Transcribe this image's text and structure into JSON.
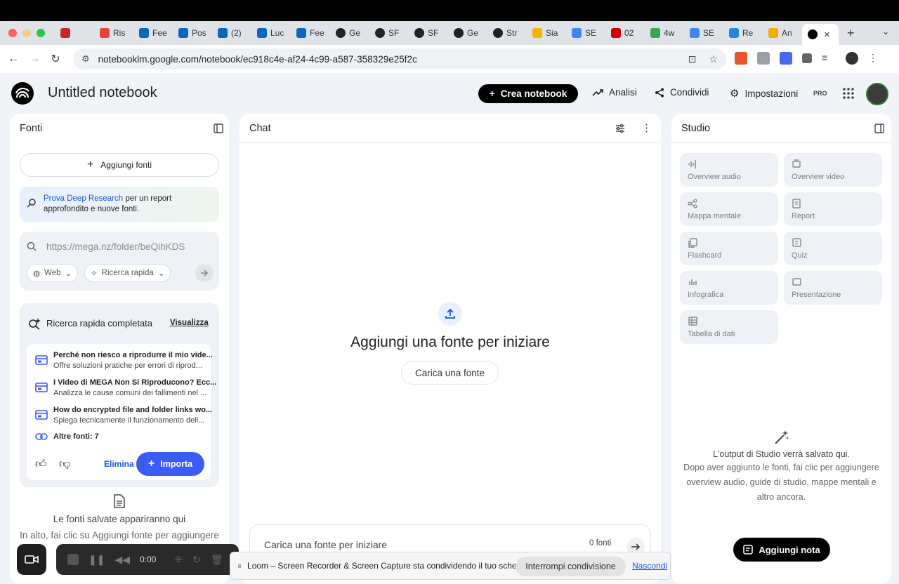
{
  "browser": {
    "tabs": [
      {
        "label": "",
        "color": "#c62828"
      },
      {
        "label": "Ris",
        "color": "#ea4335"
      },
      {
        "label": "Fee",
        "color": "#0a66c2"
      },
      {
        "label": "Pos",
        "color": "#0a66c2"
      },
      {
        "label": "(2)",
        "color": "#0a66c2"
      },
      {
        "label": "Luc",
        "color": "#0a66c2"
      },
      {
        "label": "Fee",
        "color": "#0a66c2"
      },
      {
        "label": "Ge",
        "color": "#222222"
      },
      {
        "label": "SF",
        "color": "#222222"
      },
      {
        "label": "SF",
        "color": "#222222"
      },
      {
        "label": "Ge",
        "color": "#222222"
      },
      {
        "label": "Str",
        "color": "#222222"
      },
      {
        "label": "Sia",
        "color": "#f4b400"
      },
      {
        "label": "SE",
        "color": "#4285f4"
      },
      {
        "label": "02",
        "color": "#d50000"
      },
      {
        "label": "4w",
        "color": "#34a853"
      },
      {
        "label": "SE",
        "color": "#4285f4"
      },
      {
        "label": "Re",
        "color": "#1e88e5"
      },
      {
        "label": "An",
        "color": "#f9ab00"
      }
    ],
    "url": "notebooklm.google.com/notebook/ec918c4e-af24-4c99-a587-358329e25f2c"
  },
  "header": {
    "title": "Untitled notebook",
    "create_label": "Crea notebook",
    "analytics_label": "Analisi",
    "share_label": "Condividi",
    "settings_label": "Impostazioni",
    "pro_label": "PRO"
  },
  "sources": {
    "title": "Fonti",
    "add_label": "Aggiungi fonti",
    "deep_link": "Prova Deep Research",
    "deep_text_1": " per un report",
    "deep_text_2": "approfondito e nuove fonti.",
    "search_placeholder": "https://mega.nz/folder/beQihKDS",
    "chip_web": "Web",
    "chip_quick": "Ricerca rapida",
    "quick": {
      "title": "Ricerca rapida completata",
      "view_label": "Visualizza",
      "items": [
        {
          "title": "Perché non riesco a riprodurre il mio vide...",
          "desc": "Offre soluzioni pratiche per errori di riprod..."
        },
        {
          "title": "I Video di MEGA Non Si Riproducono? Ecc...",
          "desc": "Analizza le cause comuni dei fallimenti nel ..."
        },
        {
          "title": "How do encrypted file and folder links wo...",
          "desc": "Spiega tecnicamente il funzionamento dell..."
        }
      ],
      "more_label": "Altre fonti: 7",
      "delete_label": "Elimina",
      "import_label": "Importa"
    },
    "empty_title": "Le fonti salvate appariranno qui",
    "empty_text": "In alto, fai clic su Aggiungi fonte per aggiungere"
  },
  "chat": {
    "title": "Chat",
    "prompt_title": "Aggiungi una fonte per iniziare",
    "upload_label": "Carica una fonte",
    "input_placeholder": "Carica una fonte per iniziare",
    "source_count": "0 fonti"
  },
  "studio": {
    "title": "Studio",
    "tiles": [
      {
        "label": "Overview audio"
      },
      {
        "label": "Overview video"
      },
      {
        "label": "Mappa mentale"
      },
      {
        "label": "Report"
      },
      {
        "label": "Flashcard"
      },
      {
        "label": "Quiz"
      },
      {
        "label": "Infografica"
      },
      {
        "label": "Presentazione"
      },
      {
        "label": "Tabella di dati"
      }
    ],
    "empty_title": "L'output di Studio verrà salvato qui.",
    "empty_text": "Dopo aver aggiunto le fonti, fai clic per aggiungere overview audio, guide di studio, mappe mentali e altro ancora.",
    "add_note_label": "Aggiungi nota"
  },
  "loom": {
    "timer": "0:00",
    "share_text": "Loom – Screen Recorder & Screen Capture sta condividendo il tuo schermo.",
    "stop_label": "Interrompi condivisione",
    "hide_label": "Nascondi"
  }
}
